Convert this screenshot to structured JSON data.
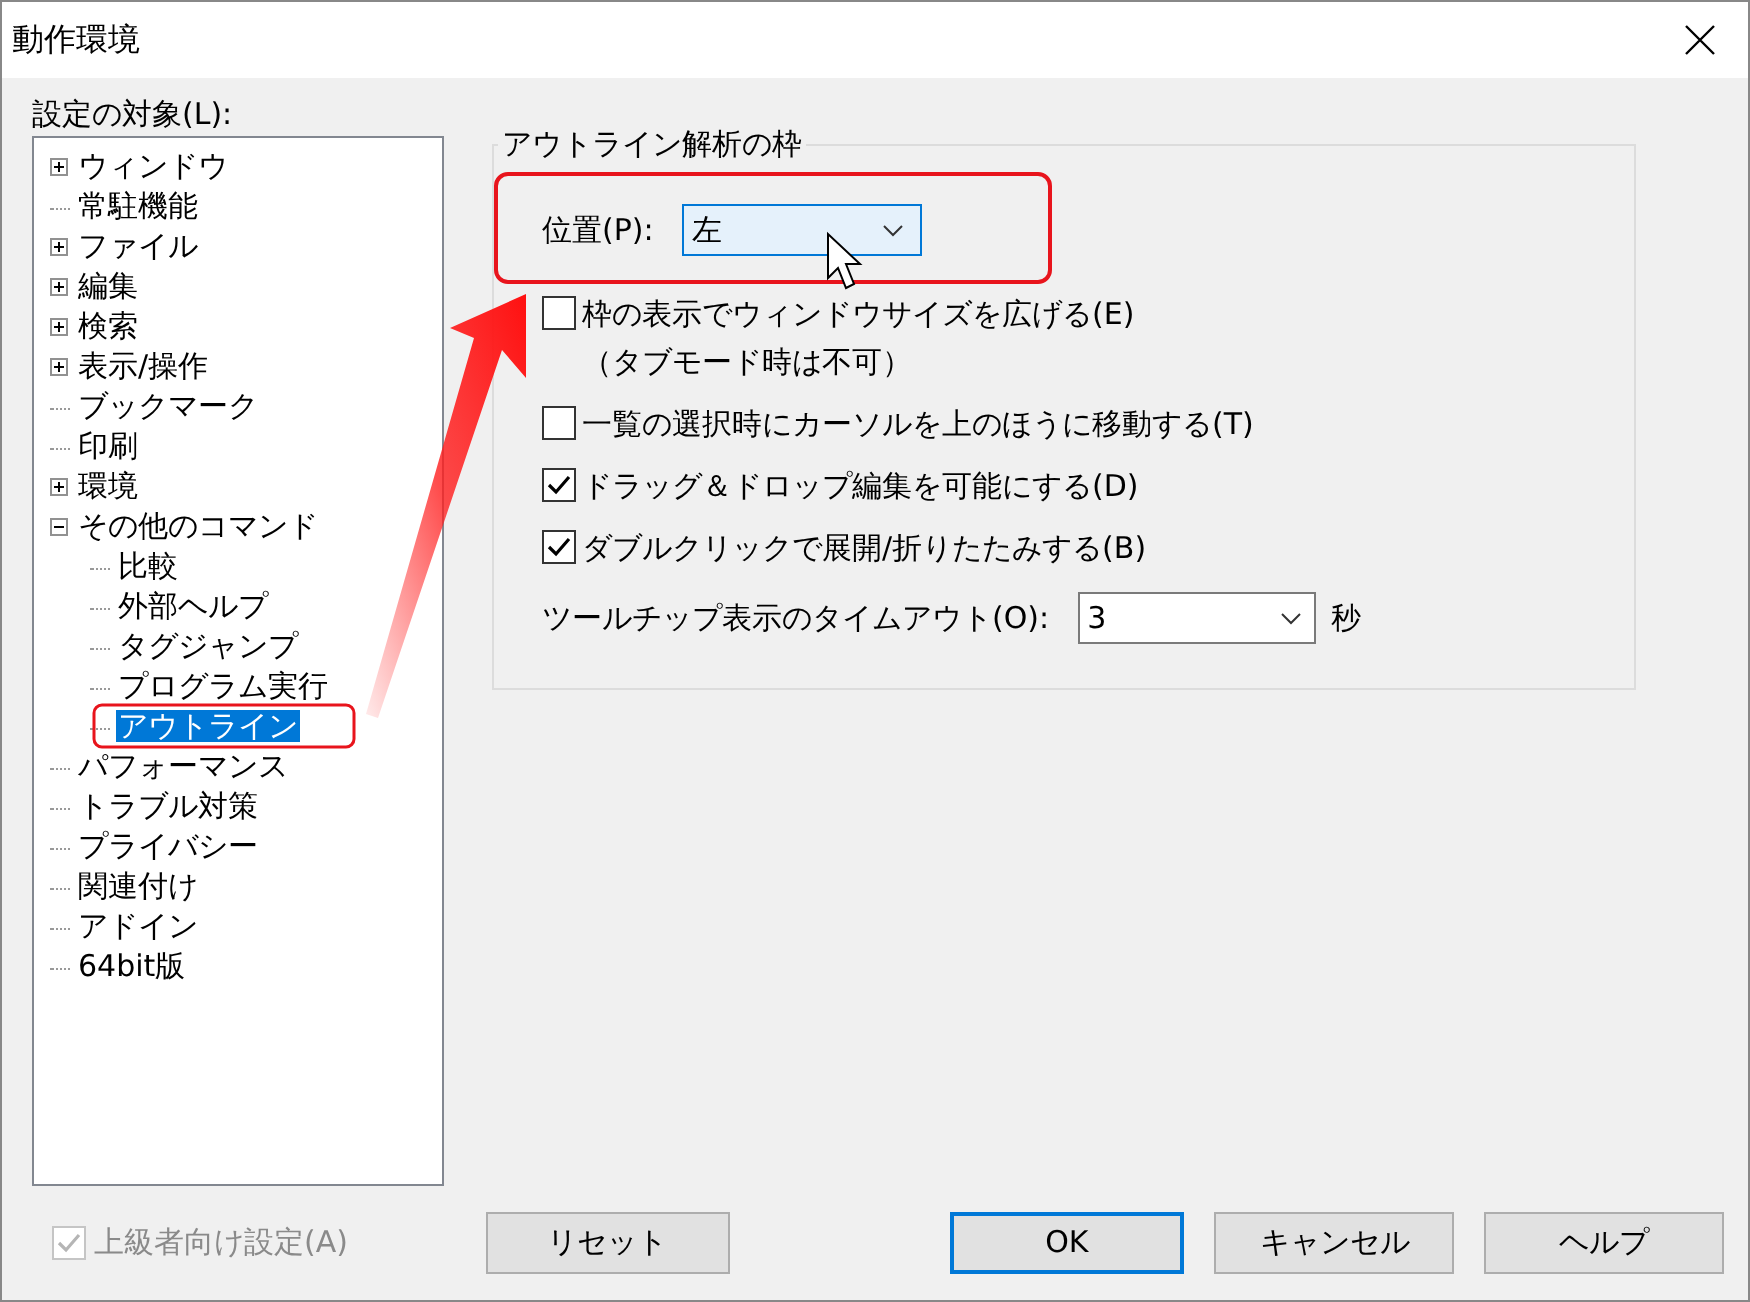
{
  "window": {
    "title": "動作環境"
  },
  "tree": {
    "label": "設定の対象(L):",
    "items": [
      {
        "label": "ウィンドウ",
        "expanded": false,
        "selected": false
      },
      {
        "label": "常駐機能",
        "selected": false
      },
      {
        "label": "ファイル",
        "expanded": false,
        "selected": false
      },
      {
        "label": "編集",
        "expanded": false,
        "selected": false
      },
      {
        "label": "検索",
        "expanded": false,
        "selected": false
      },
      {
        "label": "表示/操作",
        "expanded": false,
        "selected": false
      },
      {
        "label": "ブックマーク",
        "selected": false
      },
      {
        "label": "印刷",
        "selected": false
      },
      {
        "label": "環境",
        "expanded": false,
        "selected": false
      },
      {
        "label": "その他のコマンド",
        "expanded": true,
        "selected": false,
        "children": [
          {
            "label": "比較",
            "selected": false
          },
          {
            "label": "外部ヘルプ",
            "selected": false
          },
          {
            "label": "タグジャンプ",
            "selected": false
          },
          {
            "label": "プログラム実行",
            "selected": false
          },
          {
            "label": "アウトライン",
            "selected": true
          }
        ]
      },
      {
        "label": "パフォーマンス",
        "selected": false
      },
      {
        "label": "トラブル対策",
        "selected": false
      },
      {
        "label": "プライバシー",
        "selected": false
      },
      {
        "label": "関連付け",
        "selected": false
      },
      {
        "label": "アドイン",
        "selected": false
      },
      {
        "label": "64bit版",
        "selected": false
      }
    ]
  },
  "group": {
    "title": "アウトライン解析の枠",
    "position": {
      "label": "位置(P):",
      "value": "左",
      "hover": true
    },
    "options": [
      {
        "label": "枠の表示でウィンドウサイズを広げる(E)",
        "note": "（タブモード時は不可）",
        "checked": false
      },
      {
        "label": "一覧の選択時にカーソルを上のほうに移動する(T)",
        "checked": false
      },
      {
        "label": "ドラッグ＆ドロップ編集を可能にする(D)",
        "checked": true
      },
      {
        "label": "ダブルクリックで展開/折りたたみする(B)",
        "checked": true
      }
    ],
    "timeout": {
      "label": "ツールチップ表示のタイムアウト(O):",
      "value": "3",
      "unit": "秒"
    }
  },
  "advanced": {
    "label": "上級者向け設定(A)",
    "checked": true,
    "disabled": true
  },
  "buttons": [
    {
      "label": "リセット",
      "default": false
    },
    {
      "label": "OK",
      "default": true
    },
    {
      "label": "キャンセル",
      "default": false
    },
    {
      "label": "ヘルプ",
      "default": false
    }
  ]
}
